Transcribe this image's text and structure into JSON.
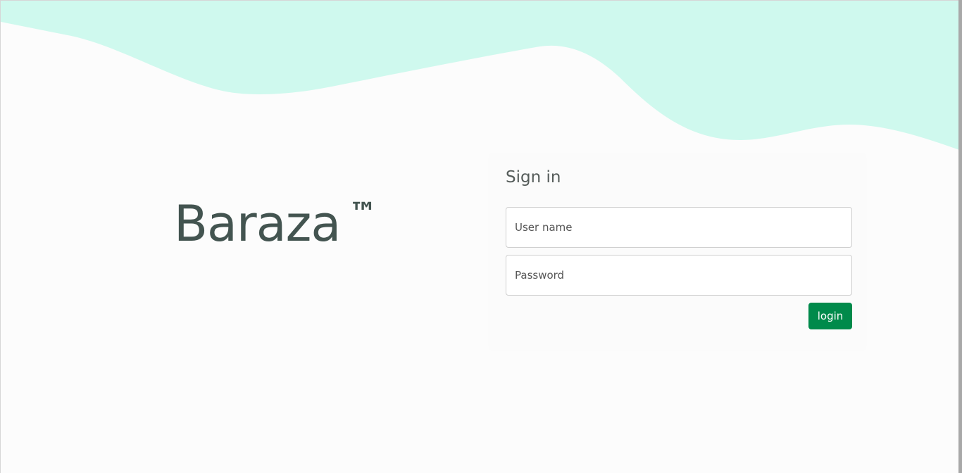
{
  "brand": {
    "name": "Baraza",
    "trademark": "™"
  },
  "signin": {
    "title": "Sign in",
    "username_placeholder": "User name",
    "username_value": "",
    "password_placeholder": "Password",
    "password_value": "",
    "login_label": "login"
  },
  "colors": {
    "wave": "#cff9ee",
    "background": "#fcfcfc",
    "brand_text": "#435450",
    "button": "#008a4b"
  }
}
